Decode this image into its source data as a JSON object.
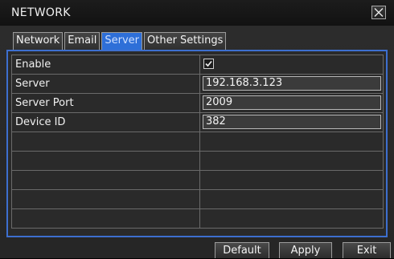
{
  "window": {
    "title": "NETWORK"
  },
  "tabs": [
    {
      "label": "Network",
      "active": false
    },
    {
      "label": "Email",
      "active": false
    },
    {
      "label": "Server",
      "active": true
    },
    {
      "label": "Other Settings",
      "active": false
    }
  ],
  "settings": {
    "enable": {
      "label": "Enable",
      "checked": true
    },
    "server": {
      "label": "Server",
      "value": "192.168.3.123"
    },
    "server_port": {
      "label": "Server Port",
      "value": "2009"
    },
    "device_id": {
      "label": "Device ID",
      "value": "382"
    }
  },
  "buttons": {
    "default_label": "Default",
    "apply_label": "Apply",
    "exit_label": "Exit"
  },
  "colors": {
    "accent": "#2e6fd8",
    "panel_border": "#3d6fcf"
  },
  "icons": {
    "close": "close-icon",
    "check": "checkmark-icon"
  }
}
